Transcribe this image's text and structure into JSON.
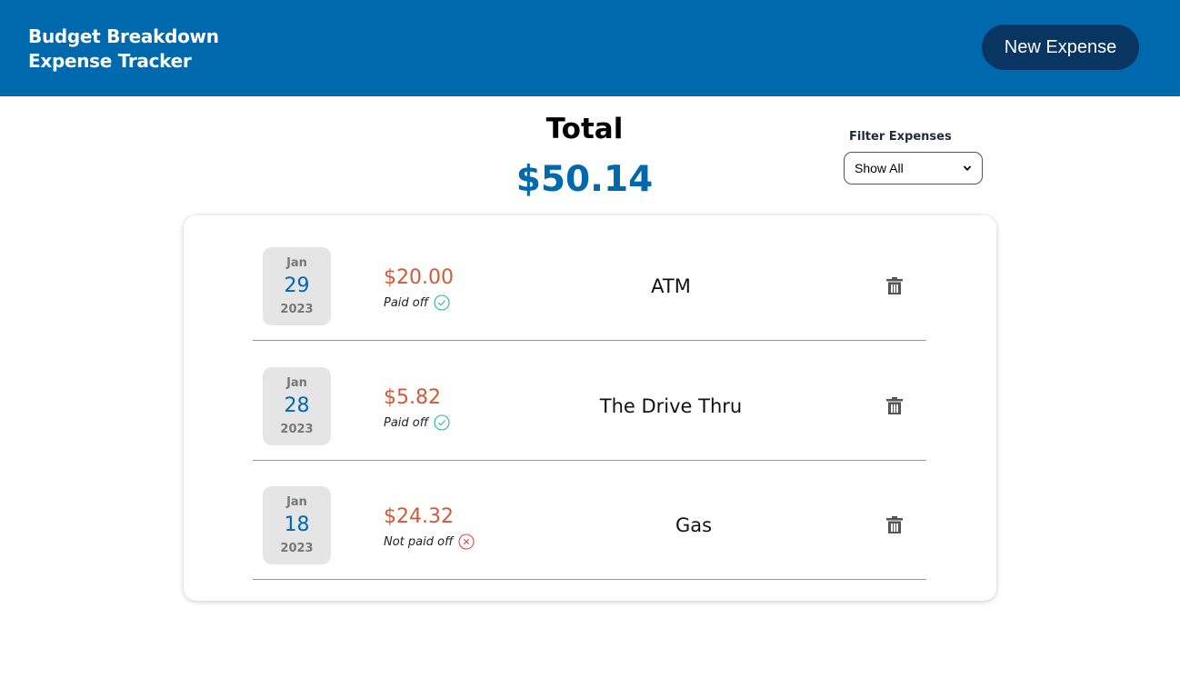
{
  "header": {
    "title_line1": "Budget Breakdown",
    "title_line2": "Expense Tracker",
    "new_expense_label": "New Expense"
  },
  "summary": {
    "total_label": "Total",
    "total_value": "$50.14"
  },
  "filter": {
    "label": "Filter Expenses",
    "selected": "Show All"
  },
  "colors": {
    "brand": "#0068ad",
    "button": "#083561",
    "amount": "#d05a3a",
    "paid": "#22b5a0",
    "unpaid": "#e04a4a"
  },
  "expenses": [
    {
      "month": "Jan",
      "day": "29",
      "year": "2023",
      "amount": "$20.00",
      "status": "Paid off",
      "status_icon": "check-circle-icon",
      "name": "ATM"
    },
    {
      "month": "Jan",
      "day": "28",
      "year": "2023",
      "amount": "$5.82",
      "status": "Paid off",
      "status_icon": "check-circle-icon",
      "name": "The Drive Thru"
    },
    {
      "month": "Jan",
      "day": "18",
      "year": "2023",
      "amount": "$24.32",
      "status": "Not paid off",
      "status_icon": "x-circle-icon",
      "name": "Gas"
    }
  ]
}
